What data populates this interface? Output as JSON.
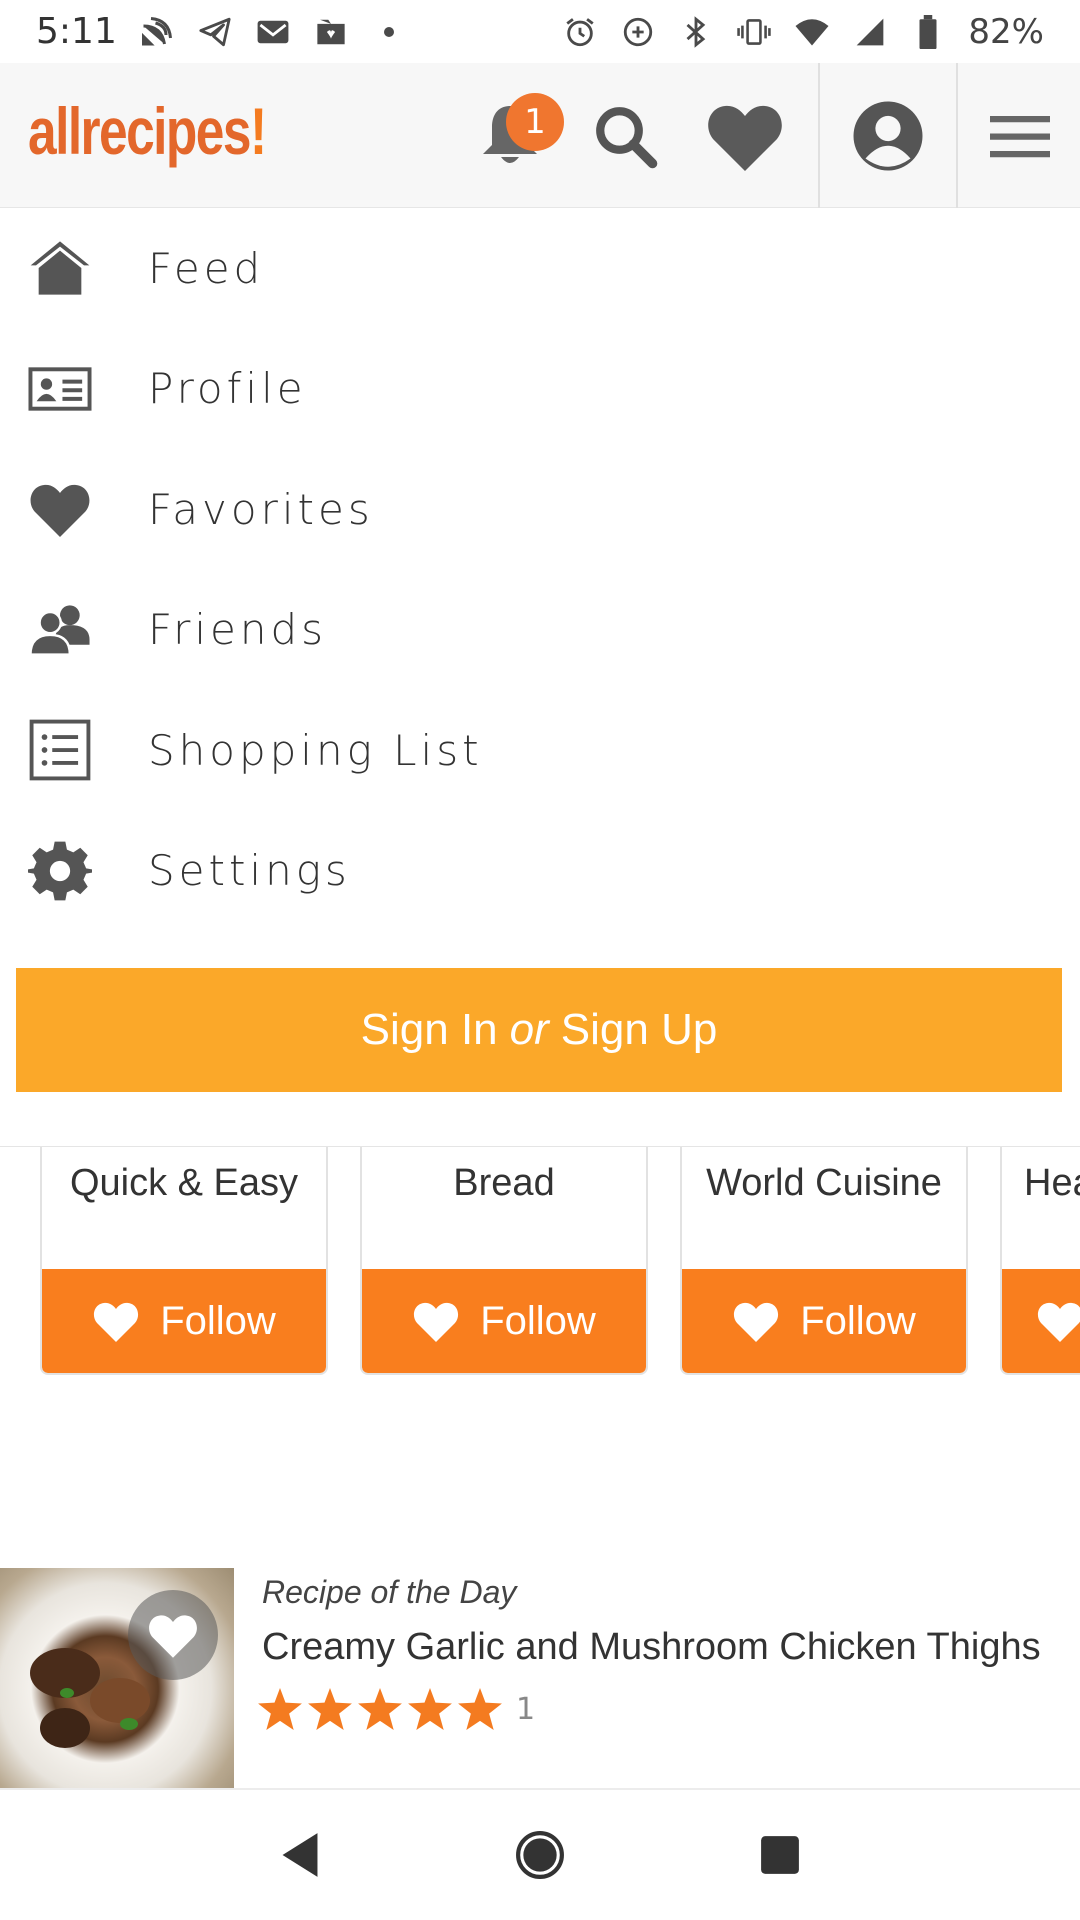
{
  "status_bar": {
    "time": "5:11",
    "battery": "82%"
  },
  "header": {
    "logo": "allrecipes",
    "notification_count": "1"
  },
  "menu": {
    "items": [
      {
        "label": "Feed",
        "icon": "home-icon"
      },
      {
        "label": "Profile",
        "icon": "id-card-icon"
      },
      {
        "label": "Favorites",
        "icon": "heart-icon"
      },
      {
        "label": "Friends",
        "icon": "friends-icon"
      },
      {
        "label": "Shopping List",
        "icon": "list-icon"
      },
      {
        "label": "Settings",
        "icon": "gear-icon"
      }
    ],
    "signin": {
      "sign_in": "Sign In",
      "or": "or",
      "sign_up": "Sign Up"
    }
  },
  "categories": [
    {
      "title": "Quick & Easy",
      "follow": "Follow"
    },
    {
      "title": "Bread",
      "follow": "Follow"
    },
    {
      "title": "World Cuisine",
      "follow": "Follow"
    },
    {
      "title": "Hea",
      "follow": ""
    }
  ],
  "recipe_of_day": {
    "label": "Recipe of the Day",
    "title": "Creamy Garlic and Mushroom Chicken Thighs",
    "rating": 5,
    "rating_count": "1"
  },
  "colors": {
    "brand_orange": "#e3672b",
    "follow_orange": "#f97e1e",
    "signin_yellow": "#fba829",
    "star_orange": "#f47b20",
    "icon_gray": "#555555"
  }
}
